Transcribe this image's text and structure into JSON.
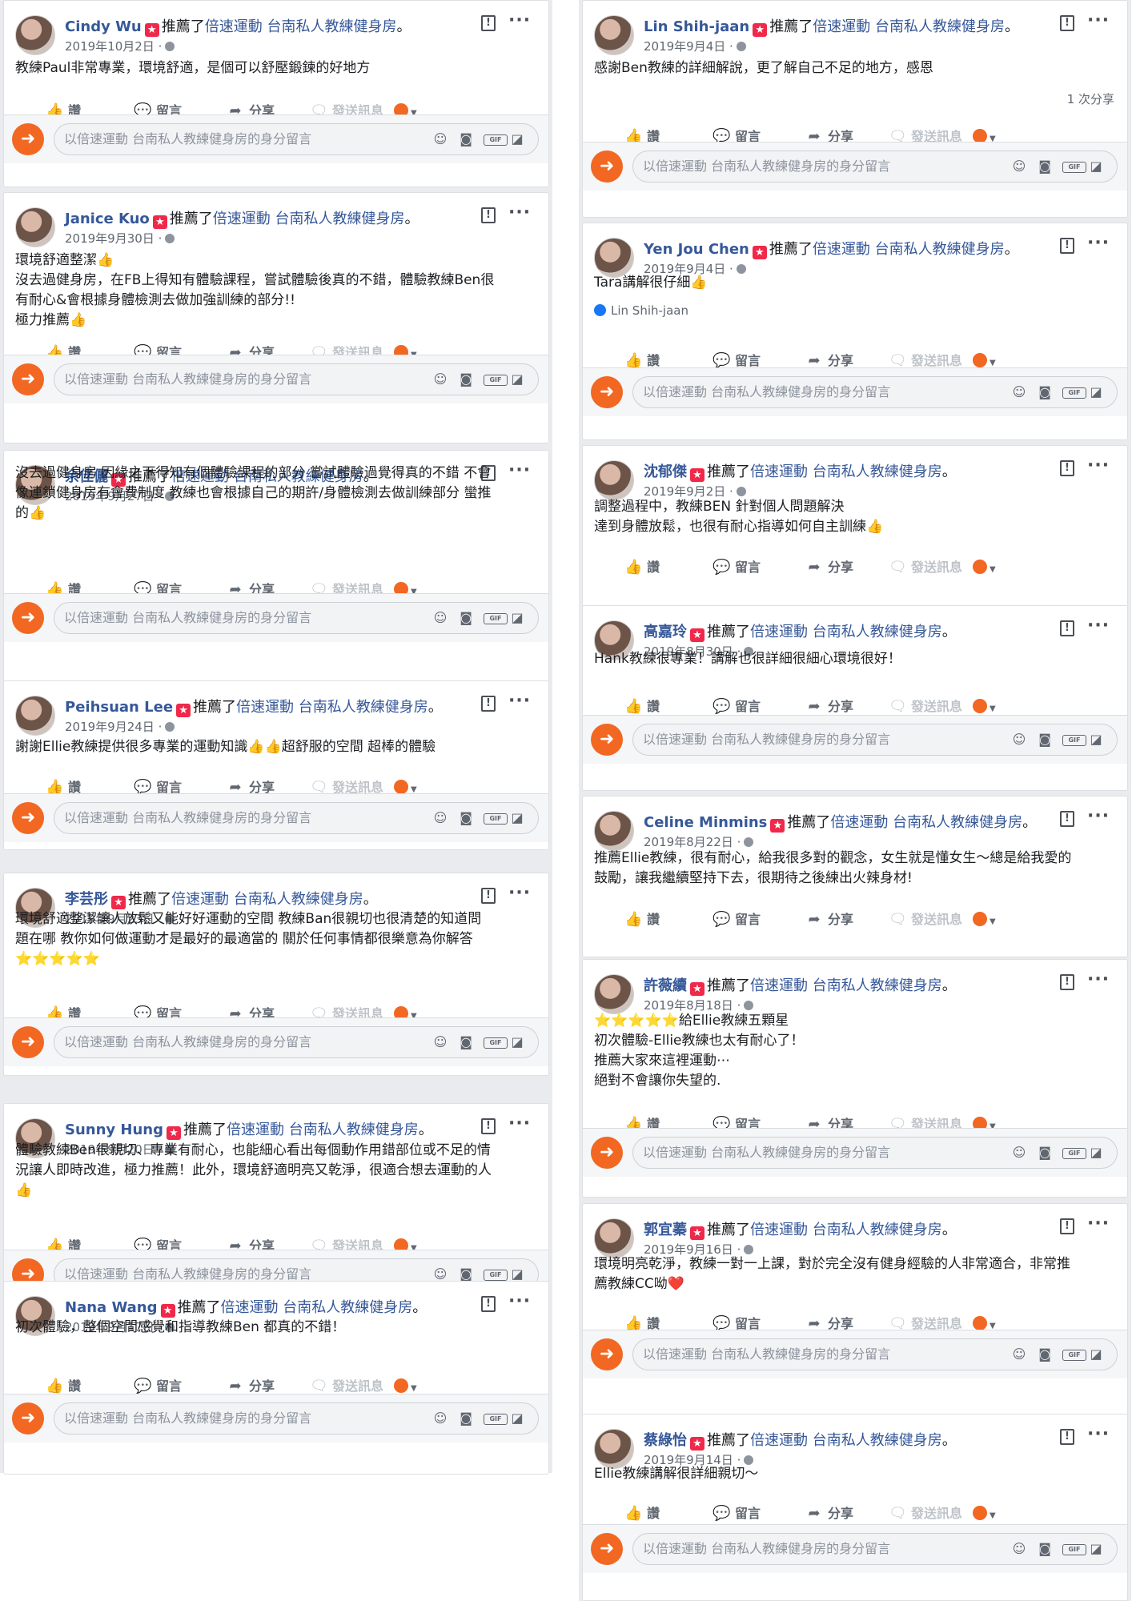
{
  "common": {
    "recommended_text": "推薦了",
    "page_name": "倍速運動 台南私人教練健身房",
    "period": "。",
    "like_label": "讚",
    "comment_label": "留言",
    "share_label": "分享",
    "message_label": "發送訊息",
    "comment_placeholder": "以倍速運動 台南私人教練健身房的身分留言",
    "gif_label": "GIF",
    "icons": {
      "like": "thumbs-up-icon",
      "comment": "speech-bubble-icon",
      "share": "share-arrow-icon",
      "message": "messenger-icon",
      "flag": "flag-icon",
      "more": "more-dots-icon",
      "emoji": "smiley-icon",
      "camera": "camera-icon",
      "sticker": "sticker-icon"
    },
    "colors": {
      "name_link": "#365899",
      "recommend_badge": "#f02849",
      "brand_orange": "#f26722",
      "feed_bg": "#e9ebee"
    }
  },
  "left": [
    {
      "name": "Cindy Wu",
      "date": "2019年10月2日",
      "lines": [
        "教練Paul非常專業，環境舒適，是個可以舒壓鍛鍊的好地方"
      ]
    },
    {
      "name": "Janice Kuo",
      "date": "2019年9月30日",
      "lines": [
        "環境舒適整潔👍",
        "沒去過健身房，在FB上得知有體驗課程，嘗試體驗後真的不錯，體驗教練Ben很",
        "有耐心&會根據身體檢測去做加強訓練的部分!!",
        "極力推薦👍"
      ]
    },
    {
      "name": "余佳儷",
      "date": "2019年9月27日",
      "lines": [
        "沒去過健身房 因緣之下得知有個體驗課程的部分 嘗試體驗過覺得真的不錯 不會",
        "像連鎖健身房有會費制度 教練也會根據自己的期許/身體檢測去做訓練部分 蠻推",
        "的👍"
      ]
    },
    {
      "name": "Peihsuan Lee",
      "date": "2019年9月24日",
      "lines": [
        "謝謝Ellie教練提供很多專業的運動知識👍👍超舒服的空間 超棒的體驗"
      ]
    },
    {
      "name": "李芸彤",
      "date": "2019年9月23日",
      "lines": [
        "環境舒適整潔讓人放鬆又能好好運動的空間 教練Ban很親切也很清楚的知道問",
        "題在哪 教你如何做運動才是最好的最適當的 關於任何事情都很樂意為你解答",
        "⭐⭐⭐⭐⭐"
      ]
    },
    {
      "name": "Sunny Hung",
      "date": "2019年9月20日",
      "lines": [
        "體驗教練Ben很親切、專業有耐心，也能細心看出每個動作用錯部位或不足的情",
        "況讓人即時改進，極力推薦！此外，環境舒適明亮又乾淨，很適合想去運動的人",
        "👍"
      ]
    },
    {
      "name": "Nana Wang",
      "date": "2019年9月17日",
      "lines": [
        "初次體驗，整個空間感覺和指導教練Ben 都真的不錯！"
      ]
    }
  ],
  "right": [
    {
      "name": "Lin Shih-jaan",
      "date": "2019年9月4日",
      "lines": [
        "感謝Ben教練的詳細解說，更了解自己不足的地方，感恩"
      ],
      "share_count": "1 次分享"
    },
    {
      "name": "Yen Jou Chen",
      "date": "2019年9月4日",
      "lines": [
        "Tara講解很仔細👍"
      ],
      "tagged": "Lin Shih-jaan"
    },
    {
      "name": "沈郁傑",
      "date": "2019年9月2日",
      "lines": [
        "調整過程中，教練BEN 針對個人問題解決",
        "達到身體放鬆，也很有耐心指導如何自主訓練👍"
      ]
    },
    {
      "name": "高嘉玲",
      "date": "2019年8月30日",
      "lines": [
        "Hank教練很專業！講解也很詳細很細心環境很好！"
      ]
    },
    {
      "name": "Celine Minmins",
      "date": "2019年8月22日",
      "lines": [
        "推薦Ellie教練，很有耐心，給我很多對的觀念，女生就是懂女生～總是給我愛的",
        "鼓勵，讓我繼續堅持下去，很期待之後練出火辣身材!"
      ]
    },
    {
      "name": "許薇續",
      "date": "2019年8月18日",
      "lines": [
        "⭐⭐⭐⭐⭐給Ellie教練五顆星",
        "初次體驗-Ellie教練也太有耐心了！",
        "推薦大家來這裡運動⋯",
        "絕對不會讓你失望的."
      ]
    },
    {
      "name": "郭宜蓁",
      "date": "2019年9月16日",
      "lines": [
        "環境明亮乾淨，教練一對一上課，對於完全沒有健身經驗的人非常適合，非常推",
        "薦教練CC呦❤️"
      ]
    },
    {
      "name": "蔡綠怡",
      "date": "2019年9月14日",
      "lines": [
        "Ellie教練講解很詳細親切～"
      ]
    }
  ]
}
